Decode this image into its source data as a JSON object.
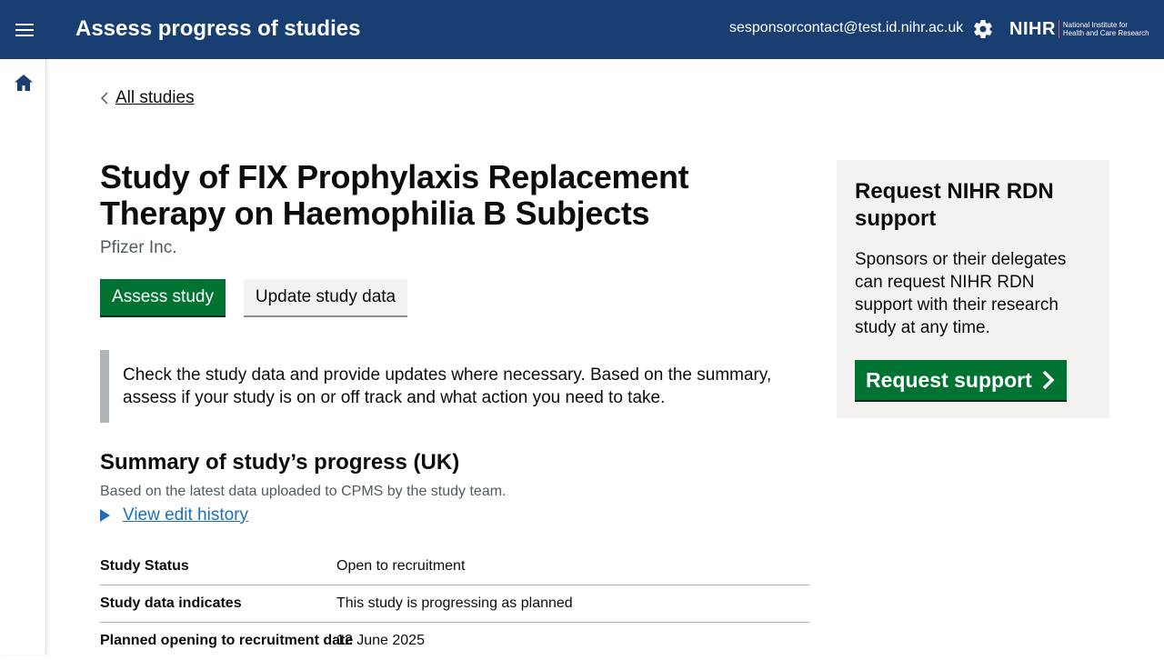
{
  "header": {
    "title": "Assess progress of studies",
    "user_email": "sesponsorcontact@test.id.nihr.ac.uk",
    "logo_text": "NIHR",
    "logo_subtitle_line1": "National Institute for",
    "logo_subtitle_line2": "Health and Care Research",
    "brand_color": "#193e72"
  },
  "nav": {
    "back_link": "All studies"
  },
  "study": {
    "title": "Study of FIX Prophylaxis Replacement Therapy on Haemophilia B Subjects",
    "sponsor": "Pfizer Inc.",
    "assess_button": "Assess study",
    "update_button": "Update study data",
    "inset_text": "Check the study data and provide updates where necessary. Based on the summary, assess if your study is on or off track and what action you need to take."
  },
  "summary": {
    "heading": "Summary of study’s progress (UK)",
    "hint": "Based on the latest data uploaded to CPMS by the study team.",
    "details_link": "View edit history",
    "rows": [
      {
        "key": "Study Status",
        "value": "Open to recruitment"
      },
      {
        "key": "Study data indicates",
        "value": "This study is progressing as planned"
      },
      {
        "key": "Planned opening to recruitment date",
        "value": "12 June 2025"
      }
    ]
  },
  "side_panel": {
    "heading": "Request NIHR RDN support",
    "body": "Sponsors or their delegates can request NIHR RDN support with their research study at any time.",
    "button": "Request support"
  },
  "colors": {
    "primary_button": "#007232",
    "link": "#1d70b8"
  },
  "icons": [
    "menu-icon",
    "gear-icon",
    "home-icon",
    "chevron-left-icon",
    "triangle-right-icon",
    "chevron-right-icon"
  ]
}
